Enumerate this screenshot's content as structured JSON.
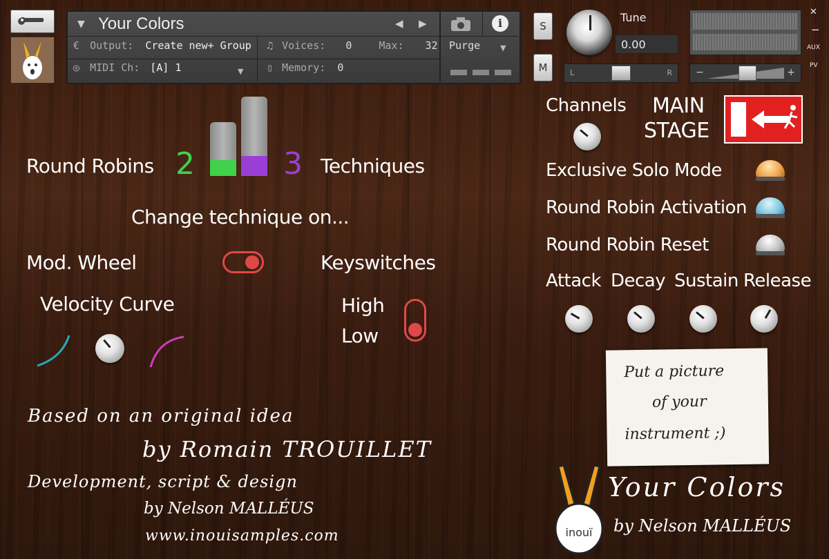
{
  "header": {
    "instrument_name": "Your Colors",
    "output_label": "Output:",
    "output_value": "Create new+ Group",
    "midi_label": "MIDI Ch:",
    "midi_value": "[A] 1",
    "voices_label": "Voices:",
    "voices_value": "0",
    "max_label": "Max:",
    "max_value": "32",
    "memory_label": "Memory:",
    "memory_value": "0",
    "purge_label": "Purge",
    "tune_label": "Tune",
    "tune_value": "0.00",
    "solo_label": "S",
    "mute_label": "M",
    "pan_left": "L",
    "pan_right": "R",
    "vol_minus": "−",
    "vol_plus": "+",
    "close_label": "✕",
    "minimize_label": "−",
    "aux_label": "AUX",
    "pv_label": "PV"
  },
  "main": {
    "round_robins_label": "Round Robins",
    "round_robins_value": "2",
    "techniques_value": "3",
    "techniques_label": "Techniques",
    "round_robin_fill": 0.3,
    "technique_fill": 0.25,
    "change_technique_label": "Change technique on...",
    "mod_wheel_label": "Mod. Wheel",
    "keyswitches_label": "Keyswitches",
    "velocity_curve_label": "Velocity Curve",
    "high_label": "High",
    "low_label": "Low"
  },
  "right": {
    "channels_label": "Channels",
    "main_stage_line1": "MAIN",
    "main_stage_line2": "STAGE",
    "exclusive_solo_label": "Exclusive Solo Mode",
    "rr_activation_label": "Round Robin Activation",
    "rr_reset_label": "Round Robin Reset",
    "attack_label": "Attack",
    "decay_label": "Decay",
    "sustain_label": "Sustain",
    "release_label": "Release"
  },
  "credits": {
    "line1": "Based on an original idea",
    "line2": "by Romain TROUILLET",
    "line3": "Development, script & design",
    "line4": "by Nelson MALLÉUS",
    "line5": "www.inouisamples.com"
  },
  "note": {
    "line1": "Put a picture",
    "line2": "of your",
    "line3": "instrument ;)"
  },
  "brand": {
    "logo_text": "inouï",
    "product_name": "Your Colors",
    "product_author": "by Nelson MALLÉUS"
  },
  "colors": {
    "green": "#3fd24a",
    "purple": "#9a3fd6",
    "toggle_red": "#e04848",
    "curve_teal": "#2aa8b8",
    "curve_magenta": "#cc3fb8"
  }
}
